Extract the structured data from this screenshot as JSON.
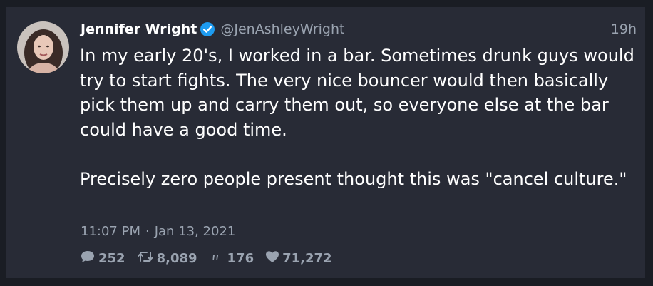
{
  "tweet": {
    "author_name": "Jennifer Wright",
    "handle": "@JenAshleyWright",
    "relative_time": "19h",
    "paragraphs": [
      "In my early 20's, I worked in a bar. Sometimes drunk guys would try to start fights. The very nice bouncer would then basically pick them up and carry them out, so everyone else at the bar could have a good time.",
      "Precisely zero people present thought this was \"cancel culture.\""
    ],
    "time": "11:07 PM",
    "separator": "·",
    "date": "Jan 13, 2021",
    "stats": {
      "replies": "252",
      "retweets": "8,089",
      "quotes": "176",
      "likes": "71,272"
    }
  },
  "colors": {
    "background": "#1a1d24",
    "card": "#282b36",
    "text": "#ffffff",
    "muted": "#9aa3b0",
    "verified": "#1d9bf0"
  },
  "icons": {
    "reply": "speech-bubble-icon",
    "retweet": "retweet-icon",
    "quote": "quote-icon",
    "like": "heart-icon",
    "verified": "verified-badge-icon"
  }
}
